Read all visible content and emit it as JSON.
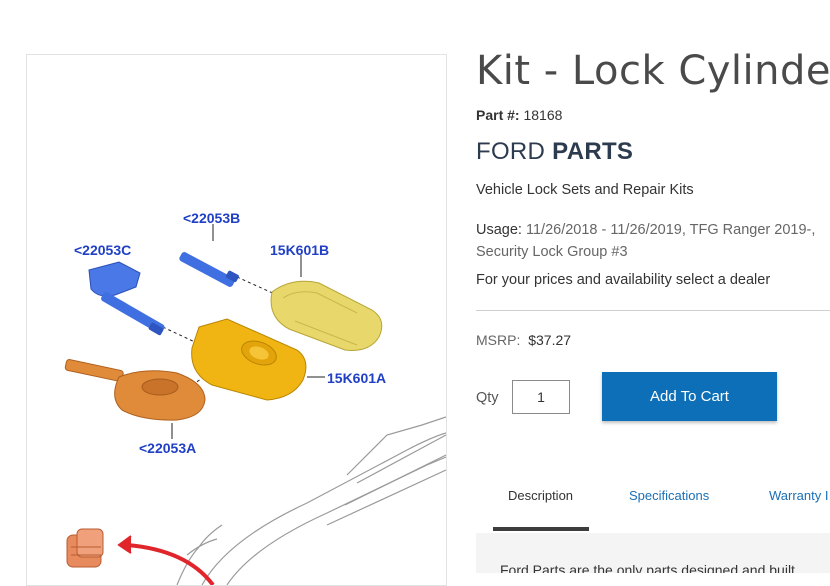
{
  "product": {
    "title": "Kit - Lock Cylinder",
    "part_label": "Part #:",
    "part_number": "18168",
    "brand_first": "FORD",
    "brand_second": "PARTS",
    "category": "Vehicle Lock Sets and Repair Kits",
    "usage_label": "Usage:",
    "usage_line1": "11/26/2018 - 11/26/2019, TFG Ranger 2019-,",
    "usage_line2": "Security Lock Group #3",
    "dealer_prompt": "For your prices and availability select a dealer",
    "msrp_label": "MSRP:",
    "msrp_value": "$37.27"
  },
  "cart": {
    "qty_label": "Qty",
    "qty_value": "1",
    "add_button": "Add To Cart"
  },
  "tabs": [
    {
      "label": "Description"
    },
    {
      "label": "Specifications"
    },
    {
      "label": "Warranty I"
    }
  ],
  "description_preview": "Ford Parts are the only parts designed and built",
  "diagram": {
    "callouts": [
      "<22053B",
      "<22053C",
      "15K601B",
      "15K601A",
      "<22053A"
    ],
    "colors": {
      "callout": "#1f3fc4",
      "blade_blue": "#3f6fe0",
      "fob_light": "#e8d76a",
      "fob_gold": "#f0b513",
      "key_orange": "#df8b3a",
      "arrow_red": "#e0262b"
    }
  },
  "colors": {
    "primary_button": "#0c6fb7",
    "link": "#1a6fb5",
    "title_text": "#4a4a4a",
    "brand_text": "#2d3b4f"
  }
}
